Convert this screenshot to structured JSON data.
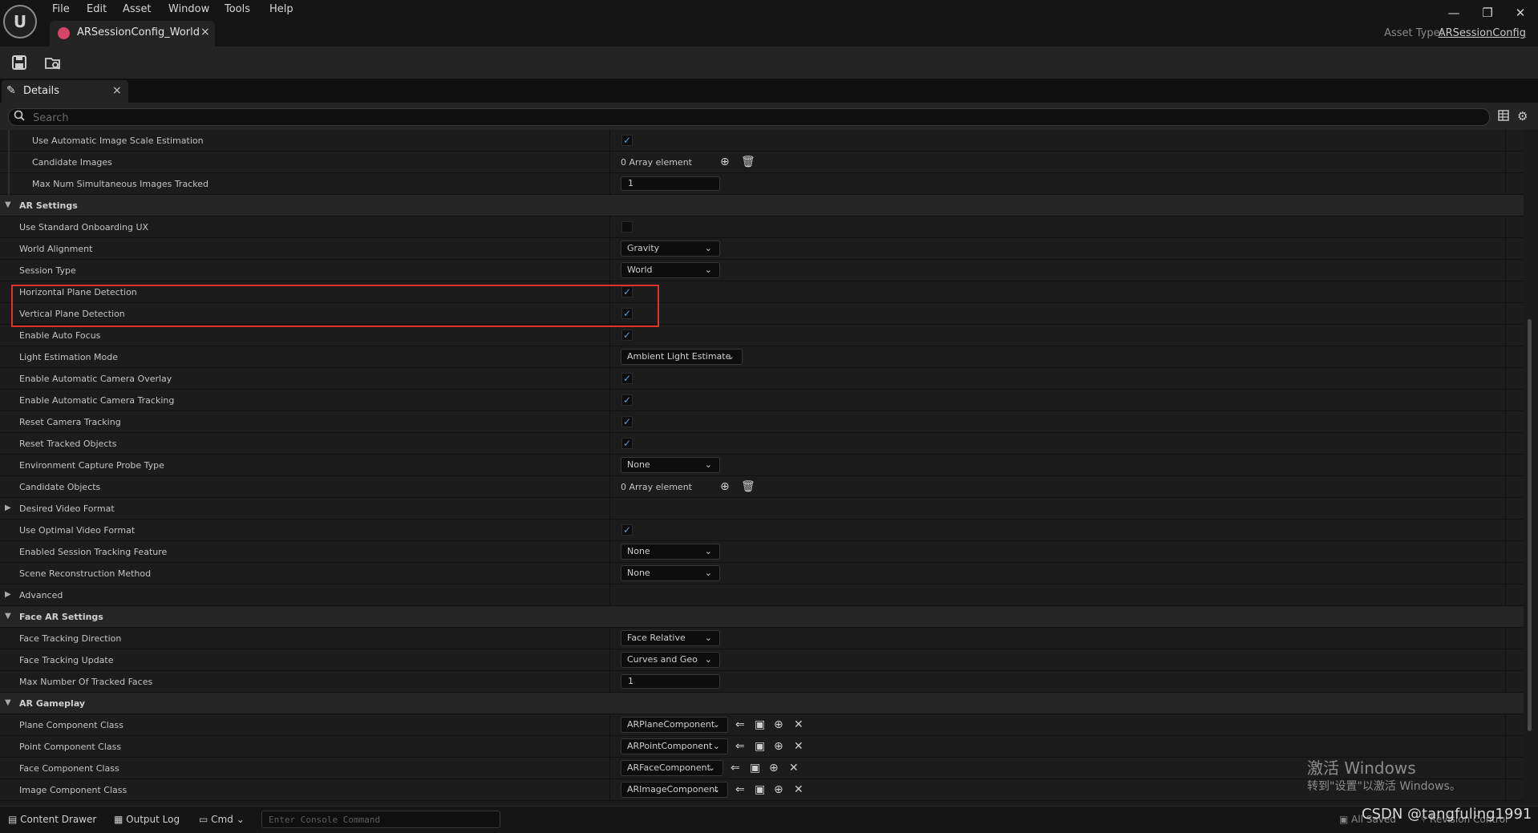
{
  "menu": [
    "File",
    "Edit",
    "Asset",
    "Window",
    "Tools",
    "Help"
  ],
  "asset_tab": {
    "label": "ARSessionConfig_World",
    "close": "×"
  },
  "asset_type": {
    "label": "Asset Type:",
    "value": "ARSessionConfig"
  },
  "window_buttons": {
    "minimize": "—",
    "restore": "❐",
    "close": "✕"
  },
  "details_tab": {
    "label": "Details",
    "close": "×"
  },
  "search": {
    "placeholder": "Search"
  },
  "rows": [
    {
      "kind": "prop",
      "label": "Use Automatic Image Scale Estimation",
      "indent": 2,
      "control": "checkbox",
      "checked": true
    },
    {
      "kind": "prop",
      "label": "Candidate Images",
      "indent": 2,
      "control": "array",
      "value": "0 Array element"
    },
    {
      "kind": "prop",
      "label": "Max Num Simultaneous Images Tracked",
      "indent": 2,
      "control": "number",
      "value": "1"
    },
    {
      "kind": "category",
      "label": "AR Settings",
      "expanded": true
    },
    {
      "kind": "prop",
      "label": "Use Standard Onboarding UX",
      "indent": 1,
      "control": "checkbox",
      "checked": false
    },
    {
      "kind": "prop",
      "label": "World Alignment",
      "indent": 1,
      "control": "dropdown",
      "value": "Gravity"
    },
    {
      "kind": "prop",
      "label": "Session Type",
      "indent": 1,
      "control": "dropdown",
      "value": "World"
    },
    {
      "kind": "prop",
      "label": "Horizontal Plane Detection",
      "indent": 1,
      "control": "checkbox",
      "checked": true
    },
    {
      "kind": "prop",
      "label": "Vertical Plane Detection",
      "indent": 1,
      "control": "checkbox",
      "checked": true
    },
    {
      "kind": "prop",
      "label": "Enable Auto Focus",
      "indent": 1,
      "control": "checkbox",
      "checked": true
    },
    {
      "kind": "prop",
      "label": "Light Estimation Mode",
      "indent": 1,
      "control": "dropdown",
      "value": "Ambient Light Estimate",
      "wide": true
    },
    {
      "kind": "prop",
      "label": "Enable Automatic Camera Overlay",
      "indent": 1,
      "control": "checkbox",
      "checked": true
    },
    {
      "kind": "prop",
      "label": "Enable Automatic Camera Tracking",
      "indent": 1,
      "control": "checkbox",
      "checked": true
    },
    {
      "kind": "prop",
      "label": "Reset Camera Tracking",
      "indent": 1,
      "control": "checkbox",
      "checked": true
    },
    {
      "kind": "prop",
      "label": "Reset Tracked Objects",
      "indent": 1,
      "control": "checkbox",
      "checked": true
    },
    {
      "kind": "prop",
      "label": "Environment Capture Probe Type",
      "indent": 1,
      "control": "dropdown",
      "value": "None"
    },
    {
      "kind": "prop",
      "label": "Candidate Objects",
      "indent": 1,
      "control": "array",
      "value": "0 Array element"
    },
    {
      "kind": "group",
      "label": "Desired Video Format",
      "expanded": false
    },
    {
      "kind": "prop",
      "label": "Use Optimal Video Format",
      "indent": 1,
      "control": "checkbox",
      "checked": true
    },
    {
      "kind": "prop",
      "label": "Enabled Session Tracking Feature",
      "indent": 1,
      "control": "dropdown",
      "value": "None"
    },
    {
      "kind": "prop",
      "label": "Scene Reconstruction Method",
      "indent": 1,
      "control": "dropdown",
      "value": "None"
    },
    {
      "kind": "group",
      "label": "Advanced",
      "expanded": false
    },
    {
      "kind": "category",
      "label": "Face AR Settings",
      "expanded": true
    },
    {
      "kind": "prop",
      "label": "Face Tracking Direction",
      "indent": 1,
      "control": "dropdown",
      "value": "Face Relative"
    },
    {
      "kind": "prop",
      "label": "Face Tracking Update",
      "indent": 1,
      "control": "dropdown",
      "value": "Curves and Geo"
    },
    {
      "kind": "prop",
      "label": "Max Number Of Tracked Faces",
      "indent": 1,
      "control": "number",
      "value": "1"
    },
    {
      "kind": "category",
      "label": "AR Gameplay",
      "expanded": true
    },
    {
      "kind": "prop",
      "label": "Plane Component Class",
      "indent": 1,
      "control": "class",
      "value": "ARPlaneComponent"
    },
    {
      "kind": "prop",
      "label": "Point Component Class",
      "indent": 1,
      "control": "class",
      "value": "ARPointComponent"
    },
    {
      "kind": "prop",
      "label": "Face Component Class",
      "indent": 1,
      "control": "class",
      "value": "ARFaceComponent"
    },
    {
      "kind": "prop",
      "label": "Image Component Class",
      "indent": 1,
      "control": "class",
      "value": "ARImageComponent"
    }
  ],
  "watermark": {
    "title": "激活 Windows",
    "subtitle": "转到\"设置\"以激活 Windows。"
  },
  "statusbar": {
    "content_drawer": "Content Drawer",
    "output_log": "Output Log",
    "cmd": "Cmd",
    "console_placeholder": "Enter Console Command",
    "saved": "All Saved",
    "revision": "Revision Control"
  },
  "credit": "CSDN @tangfuling1991",
  "colors": {
    "highlight": "#e0322a",
    "accent": "#5b9be0",
    "asset_icon": "#d6446b"
  }
}
